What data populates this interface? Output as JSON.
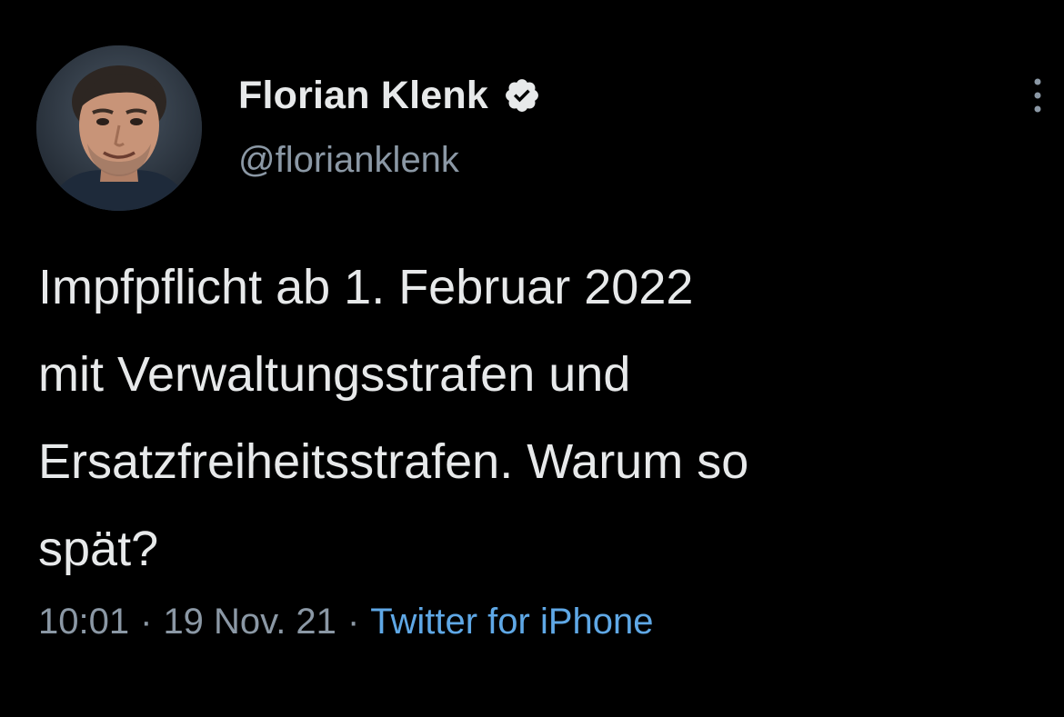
{
  "tweet": {
    "author": {
      "display_name": "Florian Klenk",
      "handle": "@florianklenk",
      "verified": true,
      "avatar_icon": "profile-photo"
    },
    "text": "Impfpflicht ab 1. Februar 2022\nmit Verwaltungsstrafen und\nErsatzfreiheitsstrafen. Warum so\nspät?",
    "meta": {
      "time": "10:01",
      "separator": "·",
      "date": "19 Nov. 21",
      "source": "Twitter for iPhone"
    },
    "more_icon": "more-vertical-icon"
  },
  "colors": {
    "background": "#000000",
    "primary_text": "#e7e9ea",
    "secondary_text": "#8b98a5",
    "link": "#5fa8e6",
    "verified_badge": "#e7e9ea"
  }
}
